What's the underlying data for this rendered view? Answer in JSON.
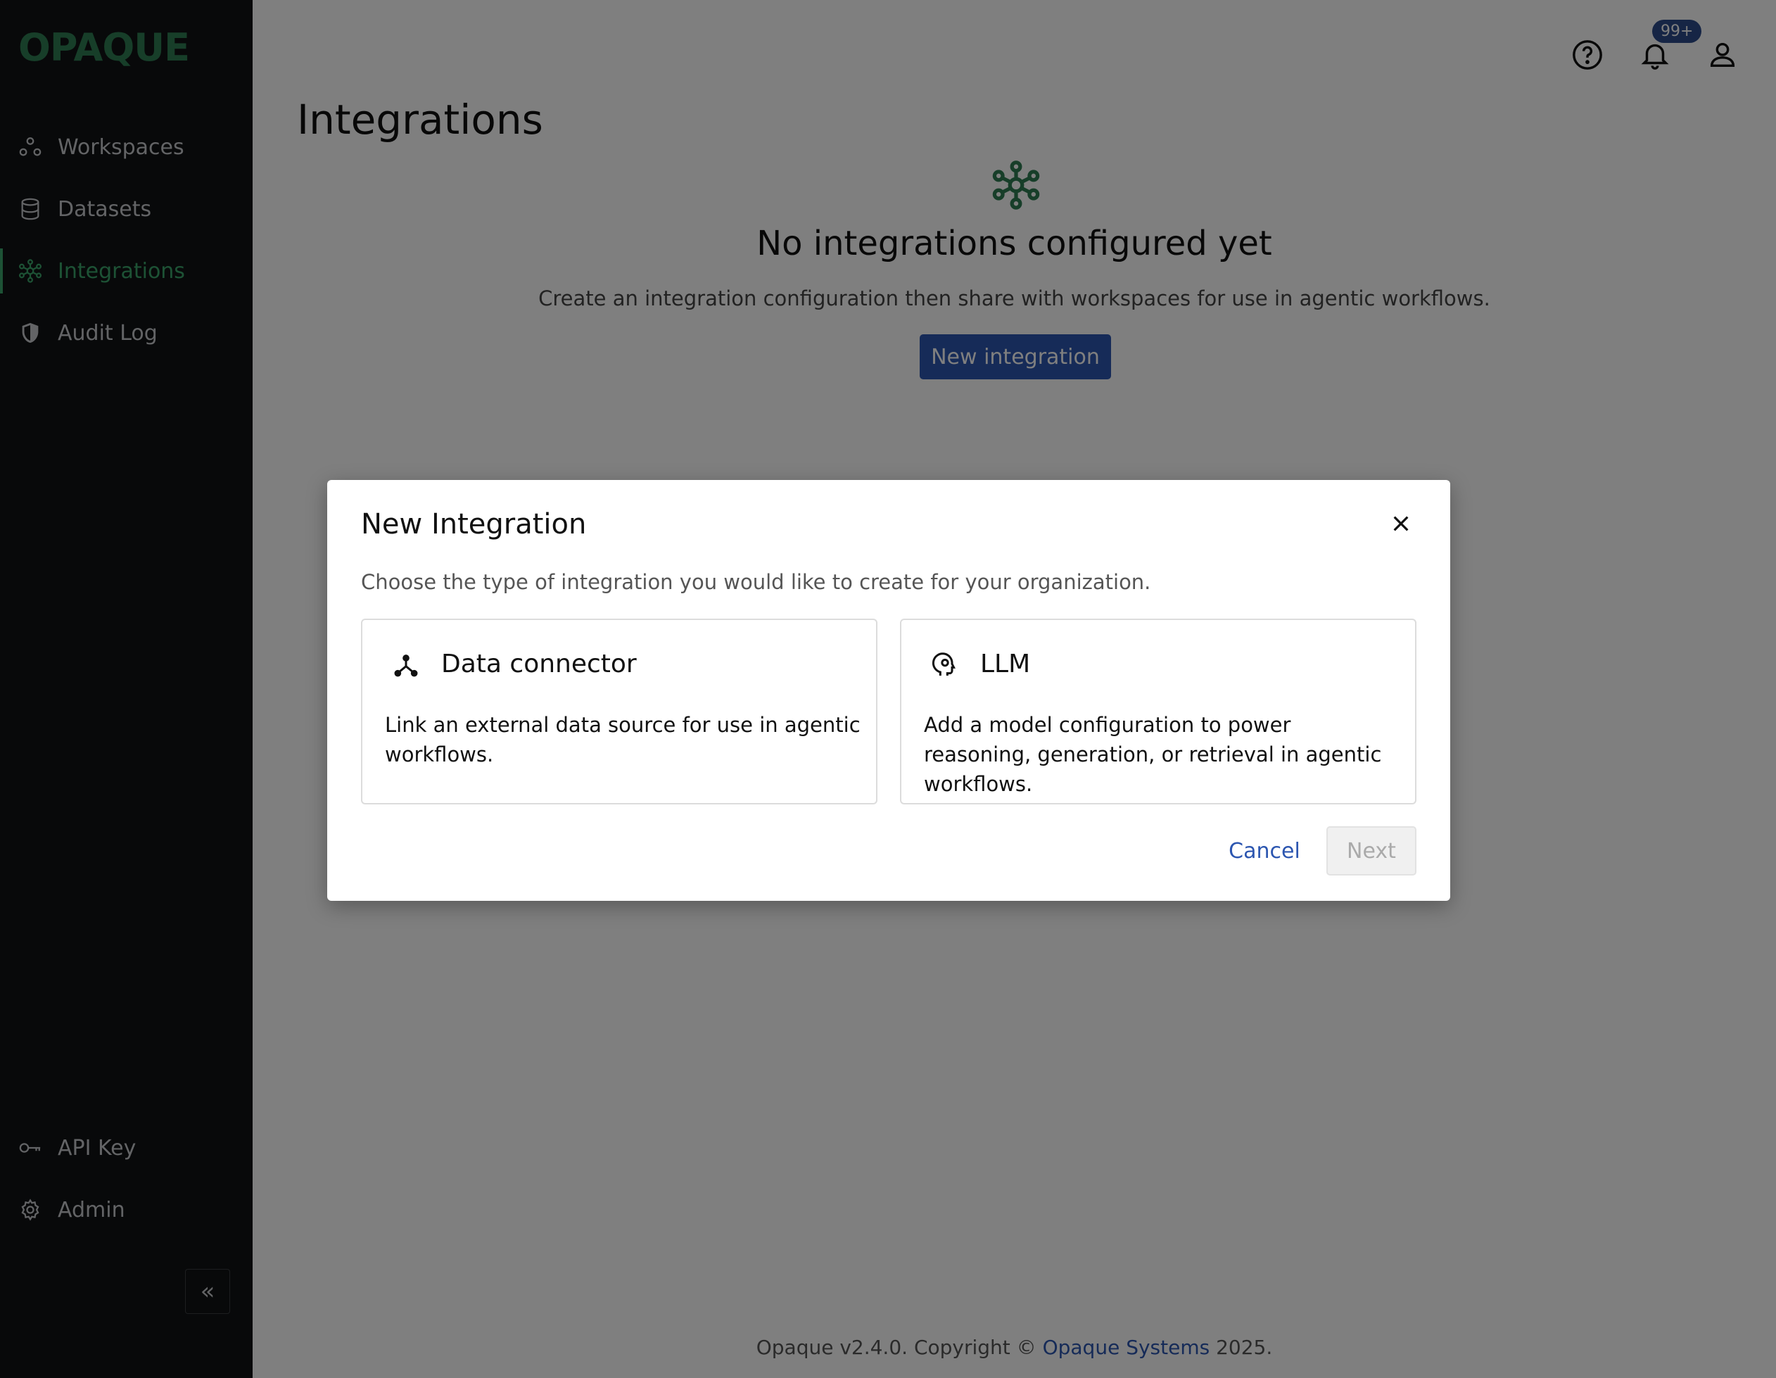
{
  "app": {
    "logo": "OPAQUE"
  },
  "sidebar": {
    "items": [
      {
        "label": "Workspaces",
        "icon": "workspaces-icon"
      },
      {
        "label": "Datasets",
        "icon": "database-icon"
      },
      {
        "label": "Integrations",
        "icon": "integrations-icon",
        "active": true
      },
      {
        "label": "Audit Log",
        "icon": "shield-icon"
      }
    ],
    "bottom_items": [
      {
        "label": "API Key",
        "icon": "key-icon"
      },
      {
        "label": "Admin",
        "icon": "gear-icon"
      }
    ],
    "collapse_glyph": "«"
  },
  "header": {
    "notification_count": "99+"
  },
  "main": {
    "title": "Integrations",
    "empty_title": "No integrations configured yet",
    "empty_subtitle": "Create an integration configuration then share with workspaces for use in agentic workflows.",
    "new_button": "New integration"
  },
  "footer": {
    "prefix": "Opaque v2.4.0. Copyright © ",
    "link": "Opaque Systems",
    "suffix": " 2025."
  },
  "modal": {
    "title": "New Integration",
    "description": "Choose the type of integration you would like to create for your organization.",
    "options": [
      {
        "title": "Data connector",
        "description": "Link an external data source for use in agentic workflows."
      },
      {
        "title": "LLM",
        "description": "Add a model configuration to power reasoning, generation, or retrieval in agentic workflows."
      }
    ],
    "cancel": "Cancel",
    "next": "Next"
  },
  "colors": {
    "brand_green": "#2e7d52",
    "active_green": "#3aa56a",
    "primary_blue": "#2c56b0",
    "sidebar_bg": "#111315"
  }
}
